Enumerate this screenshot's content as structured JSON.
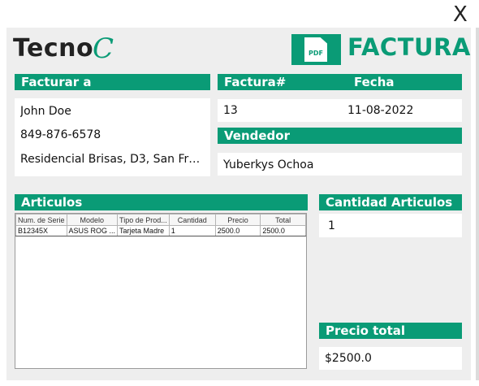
{
  "window": {
    "close_label": "X"
  },
  "brand": {
    "name": "Tecno",
    "mark": "C"
  },
  "doc": {
    "icon_text": "PDF",
    "title": "FACTURA"
  },
  "bill_to": {
    "header": "Facturar a",
    "name": "John Doe",
    "phone": "849-876-6578",
    "address": "Residencial Brisas, D3, San Fra..."
  },
  "invoice": {
    "number_header": "Factura#",
    "date_header": "Fecha",
    "number": "13",
    "date": "11-08-2022"
  },
  "seller": {
    "header": "Vendedor",
    "name": "Yuberkys Ochoa"
  },
  "items": {
    "header": "Articulos",
    "columns": [
      "Num. de Serie",
      "Modelo",
      "Tipo de Prod...",
      "Cantidad",
      "Precio",
      "Total"
    ],
    "rows": [
      [
        "B12345X",
        "ASUS ROG ...",
        "Tarjeta Madre",
        "1",
        "2500.0",
        "2500.0"
      ]
    ]
  },
  "quantity": {
    "header": "Cantidad Articulos",
    "value": "1"
  },
  "total": {
    "header": "Precio total",
    "value": "$2500.0"
  },
  "colors": {
    "accent": "#0a9b76",
    "panel": "#eeeeee"
  },
  "icons": [
    "close-icon",
    "pdf-icon"
  ]
}
